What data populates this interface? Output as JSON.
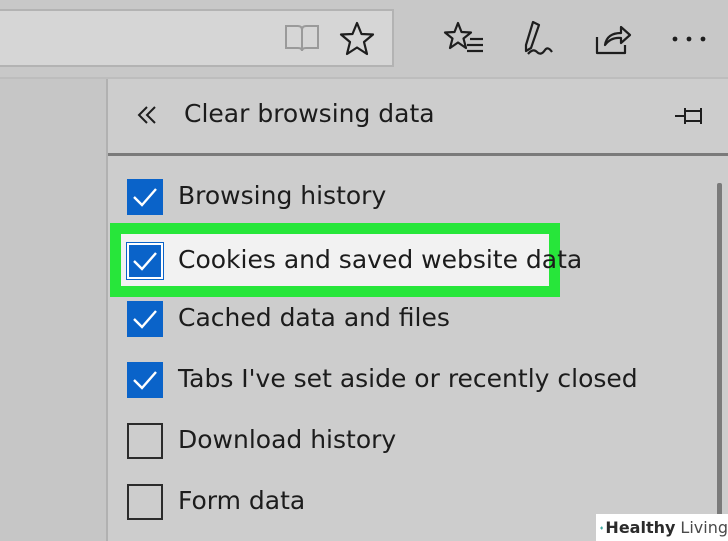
{
  "toolbar": {
    "icons": [
      "reading-view-icon",
      "favorite-star-icon",
      "hub-icon",
      "web-note-icon",
      "share-icon",
      "more-icon"
    ]
  },
  "panel": {
    "title": "Clear browsing data",
    "options": [
      {
        "label": "Browsing history",
        "checked": true
      },
      {
        "label": "Cookies and saved website data",
        "checked": true,
        "highlighted": true
      },
      {
        "label": "Cached data and files",
        "checked": true
      },
      {
        "label": "Tabs I've set aside or recently closed",
        "checked": true
      },
      {
        "label": "Download history",
        "checked": false
      },
      {
        "label": "Form data",
        "checked": false
      }
    ]
  },
  "watermark": {
    "brand": "Healthy",
    "suffix": "Living"
  },
  "colors": {
    "accent": "#0a63c9",
    "highlight": "#27e63a"
  }
}
